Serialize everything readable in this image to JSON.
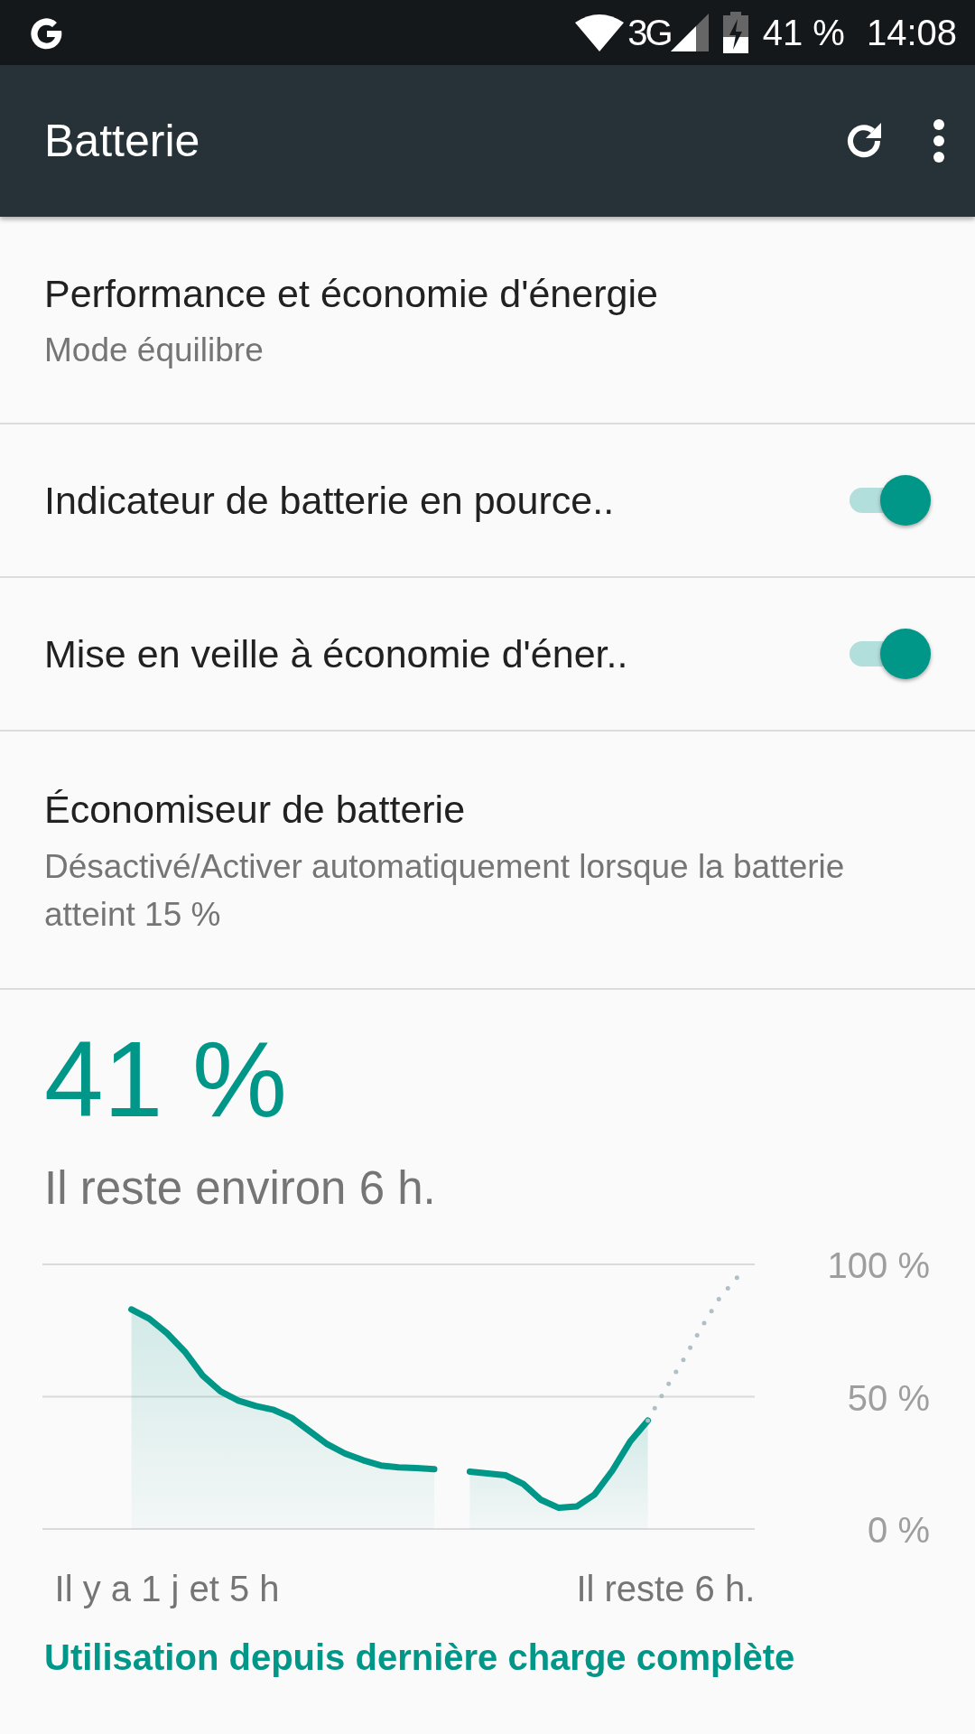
{
  "status_bar": {
    "time": "14:08",
    "battery": "41 %",
    "network": "3G"
  },
  "app_bar": {
    "title": "Batterie"
  },
  "settings": [
    {
      "kind": "text",
      "title": "Performance et économie d'énergie",
      "summary": "Mode équilibre"
    },
    {
      "kind": "switch",
      "title": "Indicateur de batterie en pource..",
      "on": true
    },
    {
      "kind": "switch",
      "title": "Mise en veille à économie d'éner..",
      "on": true
    },
    {
      "kind": "text",
      "title": "Économiseur de batterie",
      "summary": "Désactivé/Activer automatiquement lorsque la batterie atteint 15 %"
    }
  ],
  "battery": {
    "percent": "41 %",
    "remaining": "Il reste environ 6 h.",
    "chart_data": {
      "type": "line",
      "categories": [
        null,
        null,
        null,
        null,
        null,
        null,
        null,
        "Il y a 1 j et 5 h",
        null,
        null,
        null,
        null,
        null,
        null,
        null,
        null,
        null,
        null,
        null,
        null,
        null,
        null,
        null,
        null,
        null,
        null,
        null,
        null,
        null,
        null,
        null,
        null,
        null,
        null,
        null,
        "Il reste 6 h.",
        null,
        null,
        null,
        null,
        null
      ],
      "series": [
        {
          "color": "#009688",
          "line_style": "solid",
          "values": [
            null,
            null,
            null,
            null,
            null,
            83,
            79.5,
            74,
            67,
            58,
            52,
            48.5,
            46.5,
            45,
            42,
            37,
            32,
            28.5,
            26,
            24,
            23.3,
            23,
            22.6,
            null,
            null,
            null,
            null,
            null,
            null,
            null,
            null,
            null,
            null,
            null,
            null,
            null,
            null,
            null,
            null,
            null,
            null
          ]
        },
        {
          "color": "#009688",
          "line_style": "solid",
          "values": [
            null,
            null,
            null,
            null,
            null,
            null,
            null,
            null,
            null,
            null,
            null,
            null,
            null,
            null,
            null,
            null,
            null,
            null,
            null,
            null,
            null,
            null,
            null,
            null,
            21.7,
            21,
            20.3,
            17,
            11,
            8,
            8.5,
            13,
            22,
            33,
            41,
            null,
            null,
            null,
            null,
            null,
            null
          ]
        },
        {
          "color": "#b0bec5",
          "line_style": "dotted",
          "values": [
            null,
            null,
            null,
            null,
            null,
            null,
            null,
            null,
            null,
            null,
            null,
            null,
            null,
            null,
            null,
            null,
            null,
            null,
            null,
            null,
            null,
            null,
            null,
            null,
            null,
            null,
            null,
            null,
            null,
            null,
            null,
            null,
            null,
            null,
            41,
            53,
            64,
            76,
            87,
            95,
            null
          ]
        }
      ],
      "ylim": [
        0,
        100
      ],
      "yticks": [
        {
          "value": 0,
          "label": "0 %"
        },
        {
          "value": 50,
          "label": "50 %"
        },
        {
          "value": 100,
          "label": "100 %"
        }
      ]
    }
  },
  "link": "Utilisation depuis dernière charge complète"
}
